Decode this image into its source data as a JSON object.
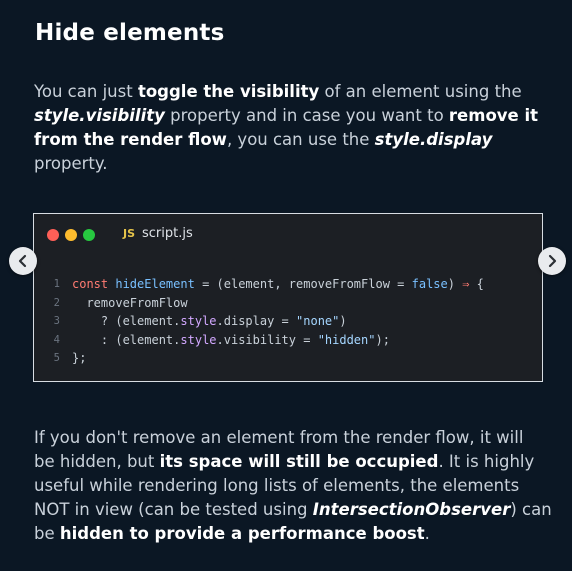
{
  "title": "Hide elements",
  "intro": {
    "line1": [
      "You can just ",
      "toggle the visibility",
      " of an element using the"
    ],
    "line2": [
      "style.visibility",
      " property and in case you want to ",
      "remove it"
    ],
    "line3": [
      "from the render flow",
      ", you can use the ",
      "style.display"
    ],
    "line4": "property."
  },
  "code_window": {
    "file_badge": "JS",
    "file_name": "script.js",
    "line_numbers": [
      "1",
      "2",
      "3",
      "4",
      "5"
    ],
    "lines": [
      [
        [
          "kw",
          "const "
        ],
        [
          "fn",
          "hideElement"
        ],
        [
          "op",
          " = ("
        ],
        [
          "var",
          "element"
        ],
        [
          "op",
          ", "
        ],
        [
          "var",
          "removeFromFlow"
        ],
        [
          "op",
          " = "
        ],
        [
          "bool",
          "false"
        ],
        [
          "op",
          ") "
        ],
        [
          "kw",
          "⇒"
        ],
        [
          "op",
          " {"
        ]
      ],
      [
        [
          "var",
          "  removeFromFlow"
        ]
      ],
      [
        [
          "op",
          "    ? ("
        ],
        [
          "var",
          "element"
        ],
        [
          "op",
          "."
        ],
        [
          "prop",
          "style"
        ],
        [
          "op",
          "."
        ],
        [
          "var",
          "display"
        ],
        [
          "op",
          " = "
        ],
        [
          "str",
          "\"none\""
        ],
        [
          "op",
          ")"
        ]
      ],
      [
        [
          "op",
          "    : ("
        ],
        [
          "var",
          "element"
        ],
        [
          "op",
          "."
        ],
        [
          "prop",
          "style"
        ],
        [
          "op",
          "."
        ],
        [
          "var",
          "visibility"
        ],
        [
          "op",
          " = "
        ],
        [
          "str",
          "\"hidden\""
        ],
        [
          "op",
          ");"
        ]
      ],
      [
        [
          "op",
          "};"
        ]
      ]
    ]
  },
  "outro": {
    "line1": "If you don't remove an element from the render flow, it will",
    "line2": [
      "be hidden, but ",
      "its space will still be occupied",
      ". It is highly"
    ],
    "line3": "useful while rendering long lists of elements, the elements",
    "line4": [
      "NOT in view (can be tested using ",
      "IntersectionObserver",
      ") can"
    ],
    "line5": [
      "be ",
      "hidden to provide a performance boost",
      "."
    ]
  },
  "nav": {
    "prev_icon": "chevron-left-icon",
    "next_icon": "chevron-right-icon"
  },
  "colors": {
    "background": "#0b1724",
    "code_background": "#1c1f24",
    "keyword": "#ff7b72",
    "function": "#79c0ff",
    "string": "#a5d6ff",
    "property": "#d2a8ff"
  }
}
